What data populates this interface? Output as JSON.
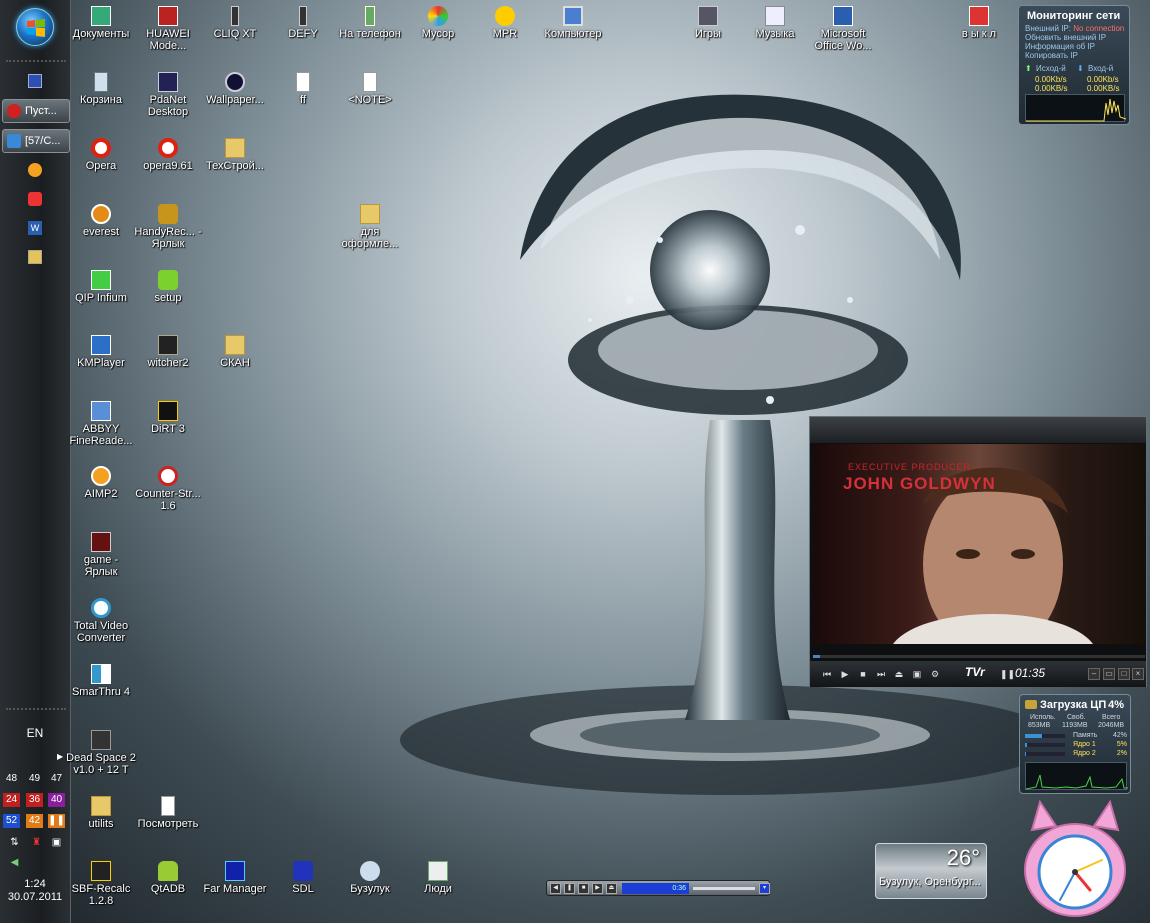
{
  "taskbar": {
    "start_label": "Start",
    "tasks": [
      {
        "label": "Пуст...",
        "icon": "opera-icon"
      },
      {
        "label": "[57/С...",
        "icon": "qip-icon"
      }
    ],
    "language": "EN",
    "tray_numbers": {
      "row1": [
        "48",
        "49",
        "47"
      ],
      "row2": [
        "24",
        "36",
        "40"
      ],
      "row3": [
        "52",
        "42"
      ]
    },
    "clock_time": "1:24",
    "clock_date": "30.07.2011"
  },
  "desktop": {
    "icons": [
      {
        "label": "Документы",
        "icon": "documents-icon"
      },
      {
        "label": "HUAWEI Mode...",
        "icon": "huawei-modem-icon"
      },
      {
        "label": "CLIQ XT",
        "icon": "phone-icon"
      },
      {
        "label": "DEFY",
        "icon": "phone-icon"
      },
      {
        "label": "На телефон",
        "icon": "phone-transfer-icon"
      },
      {
        "label": "Мусор",
        "icon": "trash-icon"
      },
      {
        "label": "MPR",
        "icon": "folder-icon"
      },
      {
        "label": "Компьютер",
        "icon": "computer-icon"
      },
      {
        "label": "Игры",
        "icon": "games-icon"
      },
      {
        "label": "Музыка",
        "icon": "music-icon"
      },
      {
        "label": "Microsoft Office Wo...",
        "icon": "word-icon"
      },
      {
        "label": "в ы к л",
        "icon": "shutdown-icon"
      },
      {
        "label": "Корзина",
        "icon": "recycle-bin-icon"
      },
      {
        "label": "PdaNet Desktop",
        "icon": "pdanet-icon"
      },
      {
        "label": "Wallpaper...",
        "icon": "wallpaper-icon"
      },
      {
        "label": "ff",
        "icon": "file-icon"
      },
      {
        "label": "<NOTE>",
        "icon": "file-icon"
      },
      {
        "label": "Opera",
        "icon": "opera-icon"
      },
      {
        "label": "opera9.61",
        "icon": "opera-icon"
      },
      {
        "label": "ТехСтрой...",
        "icon": "folder-icon"
      },
      {
        "label": "everest",
        "icon": "everest-icon"
      },
      {
        "label": "HandyRec... - Ярлык",
        "icon": "handyrec-icon"
      },
      {
        "label": "для оформле...",
        "icon": "folder-icon"
      },
      {
        "label": "QIP Infium",
        "icon": "qip-icon"
      },
      {
        "label": "setup",
        "icon": "android-setup-icon"
      },
      {
        "label": "KMPlayer",
        "icon": "kmplayer-icon"
      },
      {
        "label": "witcher2",
        "icon": "witcher-icon"
      },
      {
        "label": "СКАН",
        "icon": "folder-icon"
      },
      {
        "label": "ABBYY FineReade...",
        "icon": "abbyy-icon"
      },
      {
        "label": "DiRT 3",
        "icon": "dirt-icon"
      },
      {
        "label": "AIMP2",
        "icon": "aimp-icon"
      },
      {
        "label": "Counter-Str... 1.6",
        "icon": "counter-strike-icon"
      },
      {
        "label": "game - Ярлык",
        "icon": "game-icon"
      },
      {
        "label": "Total Video Converter",
        "icon": "video-converter-icon"
      },
      {
        "label": "SmarThru 4",
        "icon": "smarthru-icon"
      },
      {
        "label": "Dead Space 2 v1.0 + 12 T",
        "icon": "dead-space-icon"
      },
      {
        "label": "utilits",
        "icon": "utilities-icon"
      },
      {
        "label": "Посмотреть",
        "icon": "file-icon"
      },
      {
        "label": "SBF-Recalc 1.2.8",
        "icon": "sbf-recalc-icon"
      },
      {
        "label": "QtADB",
        "icon": "android-icon"
      },
      {
        "label": "Far Manager",
        "icon": "far-manager-icon"
      },
      {
        "label": "SDL",
        "icon": "sdl-icon"
      },
      {
        "label": "Бузулук",
        "icon": "weather-icon"
      },
      {
        "label": "Люди",
        "icon": "people-icon"
      }
    ]
  },
  "net_gadget": {
    "title": "Мониторинг сети",
    "external_ip_label": "Внешний IP:",
    "external_ip_value": "No connection",
    "refresh": "Обновить внешний IP",
    "info": "Информация об IP",
    "copy": "Копировать IP",
    "out_label": "Исход-й",
    "in_label": "Вход-й",
    "out_speed": "0.00Kb/s",
    "in_speed": "0.00Kb/s",
    "out_bytes": "0.00KB/s",
    "in_bytes": "0.00KB/s"
  },
  "player": {
    "credit_role": "EXECUTIVE PRODUCER",
    "credit_name": "JOHN GOLDWYN",
    "brand": "TVr",
    "time": "01:35",
    "progress": 0.02
  },
  "cpu_gadget": {
    "title": "Загрузка ЦП",
    "percent": "4%",
    "used_label": "Исполь.",
    "free_label": "Своб.",
    "total_label": "Всего",
    "used": "853MB",
    "free": "1193MB",
    "total": "2046MB",
    "memory_label": "Память",
    "memory": "42%",
    "core1_label": "Ядро 1",
    "core1": "5%",
    "core2_label": "Ядро 2",
    "core2": "2%",
    "memory_level": 0.42,
    "core1_level": 0.05,
    "core2_level": 0.02
  },
  "weather": {
    "temperature": "26°",
    "city": "Бузулук, Оренбург..."
  },
  "mini_player": {
    "time": "0:36"
  },
  "colors": {
    "accent": "#3d8fd6",
    "credit_red": "#c2272e",
    "cpu_label_yellow": "#ffe45a"
  }
}
